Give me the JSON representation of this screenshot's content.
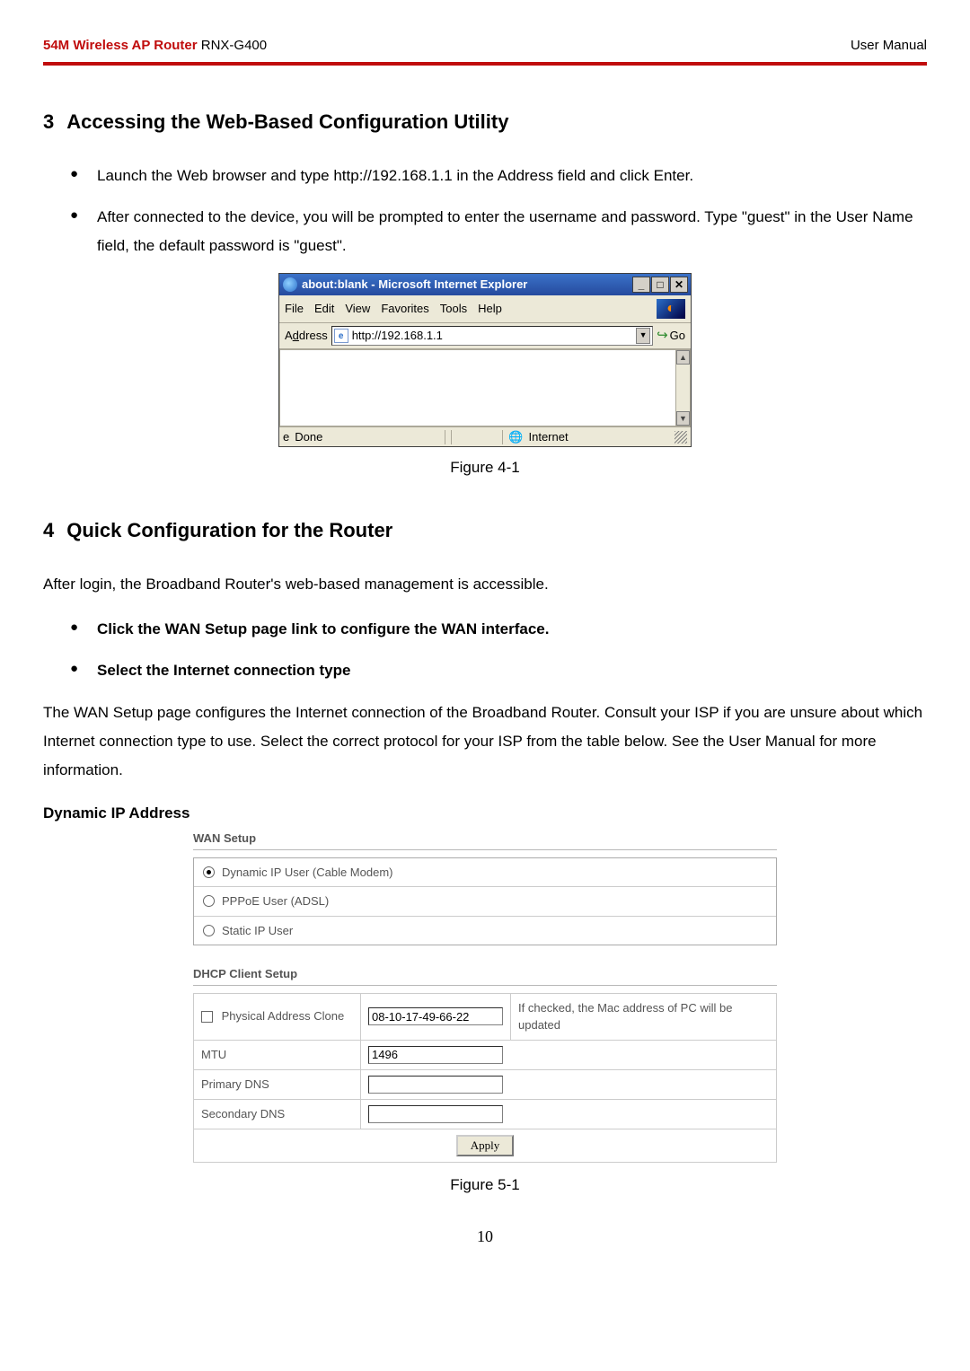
{
  "header": {
    "left_red": "54M Wireless AP Router",
    "left_model": " RNX-G400",
    "right": "User Manual"
  },
  "section3": {
    "num": "3",
    "title": "Accessing the Web-Based Configuration Utility",
    "bullets": [
      "Launch the Web browser and type http://192.168.1.1 in the Address field and click Enter.",
      "After connected to the device, you will be prompted to enter the username and password. Type \"guest\" in the User Name field, the default password is \"guest\"."
    ]
  },
  "ie": {
    "title": "about:blank - Microsoft Internet Explorer",
    "menus": [
      "File",
      "Edit",
      "View",
      "Favorites",
      "Tools",
      "Help"
    ],
    "address_label": "Address",
    "url": "http://192.168.1.1",
    "go": "Go",
    "status_done": "Done",
    "status_zone": "Internet"
  },
  "fig41": "Figure 4-1",
  "section4": {
    "num": "4",
    "title": "Quick Configuration for the Router",
    "intro": "After login, the Broadband Router's web-based management is accessible.",
    "bold_bullets": [
      "Click the WAN Setup page link to configure the WAN interface.",
      "Select the Internet connection type"
    ],
    "para": "The WAN Setup page configures the Internet connection of the Broadband Router. Consult your ISP if you are unsure about which Internet connection type to use. Select the correct protocol for your ISP from the table below. See the User Manual for more information.",
    "dyn_heading": "Dynamic IP Address"
  },
  "wan": {
    "section_title": "WAN Setup",
    "radios": [
      "Dynamic IP User (Cable Modem)",
      "PPPoE User (ADSL)",
      "Static IP User"
    ],
    "dhcp_title": "DHCP Client Setup",
    "pac_label": "Physical Address Clone",
    "mac": "08-10-17-49-66-22",
    "pac_note": "If checked, the Mac address of PC will be updated",
    "mtu_label": "MTU",
    "mtu_value": "1496",
    "pdns": "Primary DNS",
    "sdns": "Secondary DNS",
    "apply": "Apply"
  },
  "fig51": "Figure 5-1",
  "pagenum": "10"
}
